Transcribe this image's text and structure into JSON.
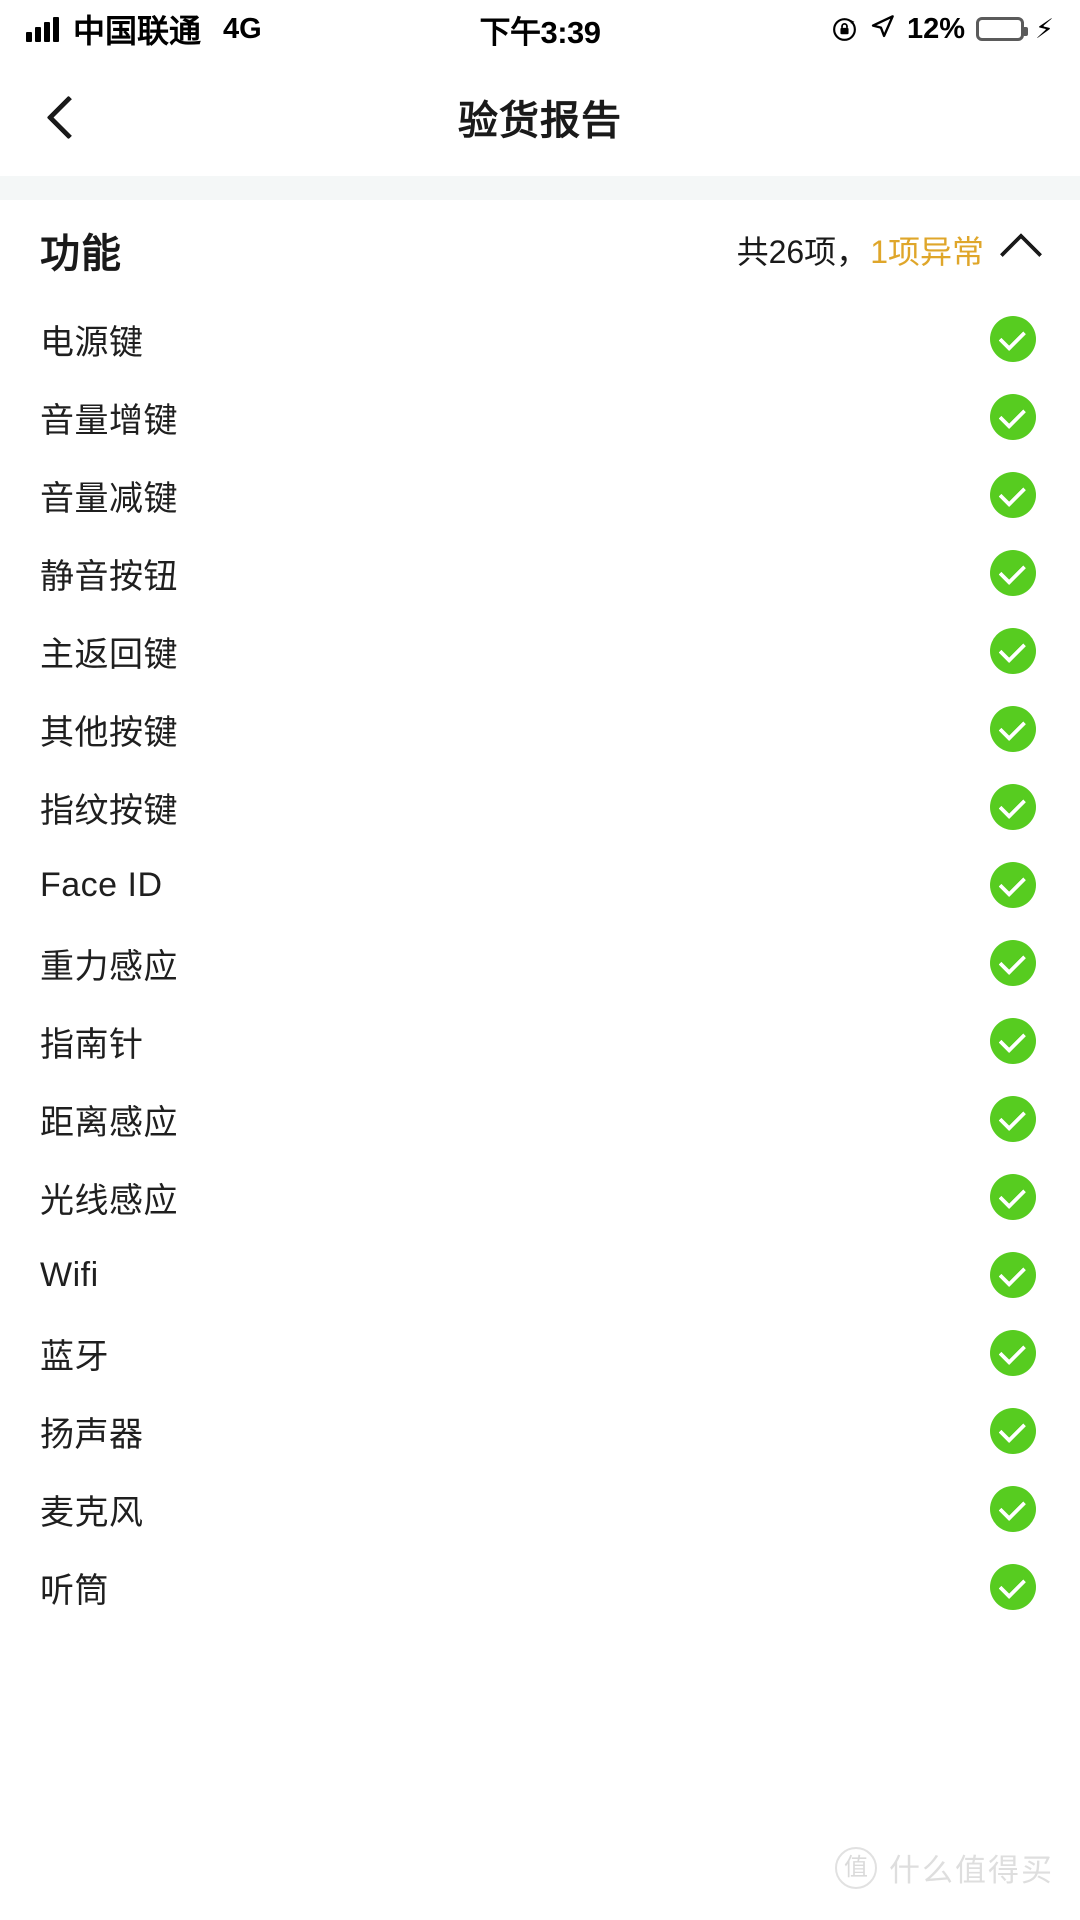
{
  "status_bar": {
    "carrier": "中国联通",
    "network": "4G",
    "time": "下午3:39",
    "battery_percent": "12%",
    "battery_level": 12,
    "icons": {
      "signal": "signal-bars-icon",
      "rotation_lock": "rotation-lock-icon",
      "location": "location-arrow-icon",
      "battery": "battery-icon",
      "charging": "lightning-bolt-icon"
    }
  },
  "nav": {
    "back_icon": "chevron-left-icon",
    "title": "验货报告"
  },
  "section": {
    "title": "功能",
    "total_text": "共26项，",
    "abnormal_text": "1项异常",
    "collapse_icon": "chevron-up-icon",
    "total_count": 26,
    "abnormal_count": 1,
    "accent_color": "#dfa62a",
    "ok_color": "#57cc20"
  },
  "items": [
    {
      "label": "电源键",
      "status": "ok"
    },
    {
      "label": "音量增键",
      "status": "ok"
    },
    {
      "label": "音量减键",
      "status": "ok"
    },
    {
      "label": "静音按钮",
      "status": "ok"
    },
    {
      "label": "主返回键",
      "status": "ok"
    },
    {
      "label": "其他按键",
      "status": "ok"
    },
    {
      "label": "指纹按键",
      "status": "ok"
    },
    {
      "label": "Face ID",
      "status": "ok"
    },
    {
      "label": "重力感应",
      "status": "ok"
    },
    {
      "label": "指南针",
      "status": "ok"
    },
    {
      "label": "距离感应",
      "status": "ok"
    },
    {
      "label": "光线感应",
      "status": "ok"
    },
    {
      "label": "Wifi",
      "status": "ok"
    },
    {
      "label": "蓝牙",
      "status": "ok"
    },
    {
      "label": "扬声器",
      "status": "ok"
    },
    {
      "label": "麦克风",
      "status": "ok"
    },
    {
      "label": "听筒",
      "status": "ok"
    }
  ],
  "watermark": {
    "logo_text": "值",
    "text": "什么值得买"
  }
}
